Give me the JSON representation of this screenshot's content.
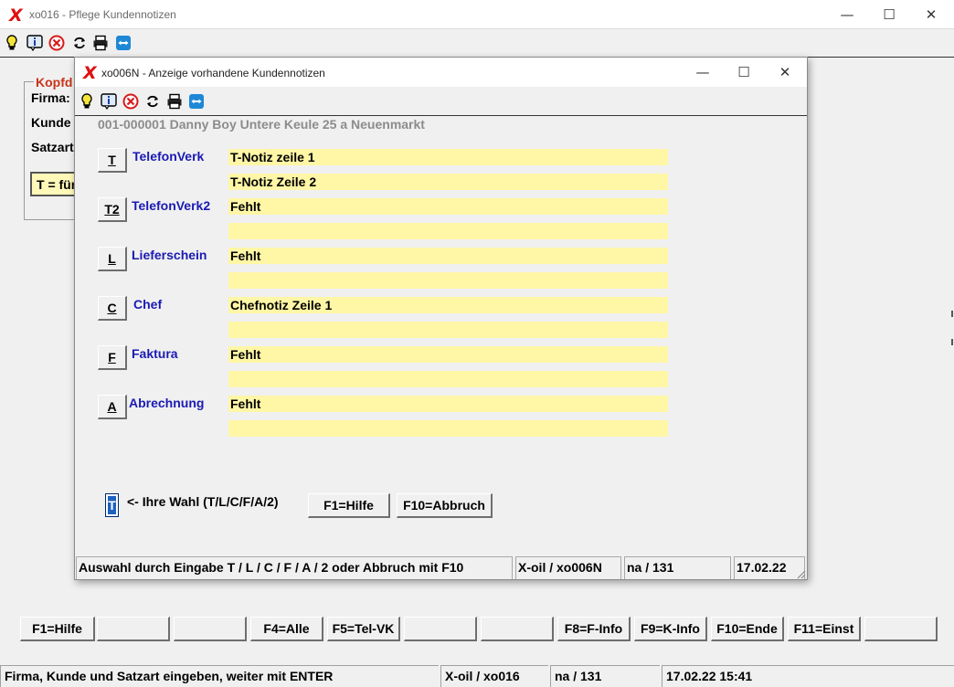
{
  "main_window": {
    "app_icon": "X",
    "title": "xo016 - Pflege Kundennotizen",
    "controls": [
      "—",
      "☐",
      "✕"
    ],
    "toolbar_icons": [
      "lightbulb-icon",
      "info-icon",
      "cancel-icon",
      "refresh-icon",
      "printer-icon",
      "teamviewer-icon"
    ],
    "form": {
      "section_title": "Kopfd",
      "firma_label": "Firma:",
      "kunde_label": "Kunde",
      "satzart_label": "Satzart",
      "satzart_value": "T = für"
    },
    "function_keys": [
      "F1=Hilfe",
      "",
      "",
      "F4=Alle",
      "F5=Tel-VK",
      "",
      "",
      "F8=F-Info",
      "F9=K-Info",
      "F10=Ende",
      "F11=Einst",
      ""
    ],
    "status": {
      "message": "Firma, Kunde und Satzart eingeben, weiter mit ENTER",
      "program": "X-oil / xo016",
      "user": "na / 131",
      "datetime": "17.02.22 15:41"
    }
  },
  "dialog": {
    "app_icon": "X",
    "title": "xo006N - Anzeige vorhandene Kundennotizen",
    "controls": [
      "—",
      "☐",
      "✕"
    ],
    "header": "001-000001 Danny Boy   Untere Keule 25 a Neuenmarkt",
    "categories": [
      {
        "key": "T",
        "label": "TelefonVerk",
        "lines": [
          "T-Notiz zeile 1",
          "T-Notiz Zeile 2"
        ]
      },
      {
        "key": "T2",
        "label": "TelefonVerk2",
        "lines": [
          "Fehlt",
          ""
        ]
      },
      {
        "key": "L",
        "label": "Lieferschein",
        "lines": [
          "Fehlt",
          ""
        ]
      },
      {
        "key": "C",
        "label": "Chef",
        "lines": [
          "Chefnotiz Zeile 1",
          ""
        ]
      },
      {
        "key": "F",
        "label": "Faktura",
        "lines": [
          "Fehlt",
          ""
        ]
      },
      {
        "key": "A",
        "label": "Abrechnung",
        "lines": [
          "Fehlt",
          ""
        ]
      }
    ],
    "choice_value": "T",
    "choice_label": "<- Ihre Wahl (T/L/C/F/A/2)",
    "help_button": "F1=Hilfe",
    "cancel_button": "F10=Abbruch",
    "status": {
      "message": "Auswahl durch Eingabe  T / L / C / F / A / 2 oder Abbruch mit F10",
      "program": "X-oil / xo006N",
      "user": "na / 131",
      "date": "17.02.22"
    }
  }
}
